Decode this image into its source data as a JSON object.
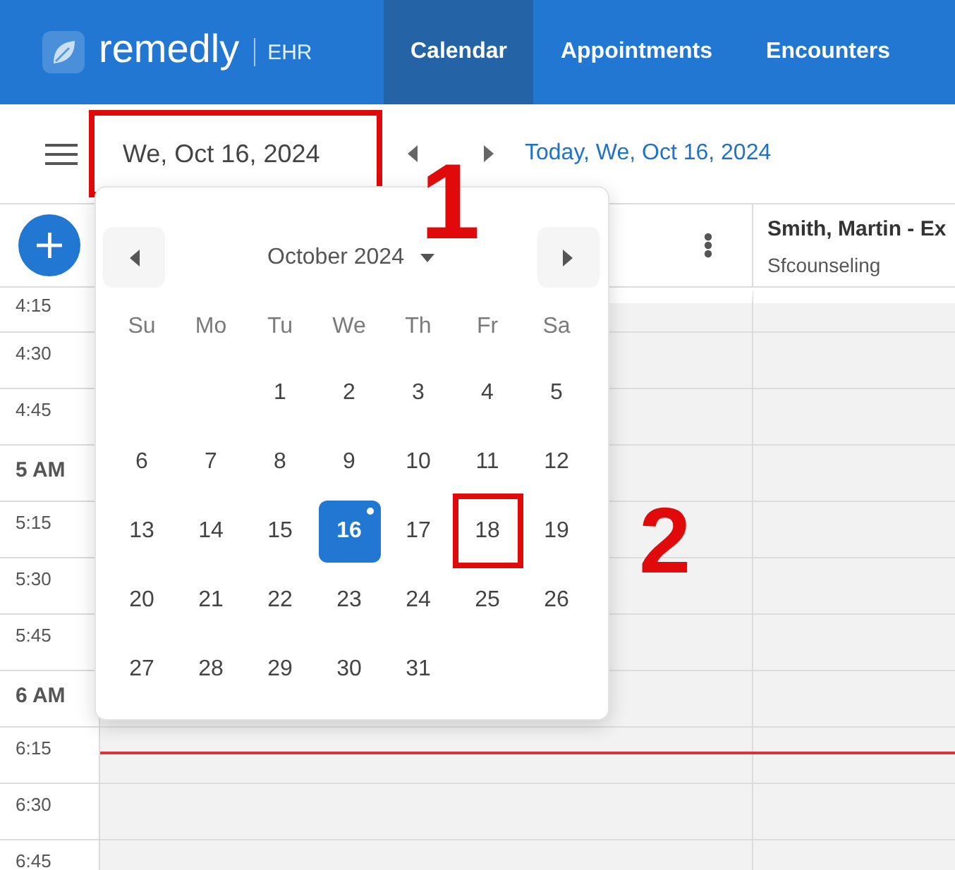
{
  "navbar": {
    "logo": {
      "wordmark": "remedly",
      "product": "EHR"
    },
    "tabs": [
      {
        "label": "Calendar",
        "selected": true
      },
      {
        "label": "Appointments",
        "selected": false
      },
      {
        "label": "Encounters",
        "selected": false
      }
    ]
  },
  "toolbar": {
    "date_field": {
      "value": "We, Oct 16, 2024",
      "highlighted": true
    },
    "today_link": "Today, We, Oct 16, 2024"
  },
  "calendar": {
    "columns": [
      {
        "menu_button": true
      },
      {
        "title": "Smith, Martin - Ex",
        "subtitle": "Sfcounseling",
        "menu_button": false
      }
    ],
    "time_slots": [
      {
        "label": "4:15",
        "kind": "quarter",
        "now": false
      },
      {
        "label": "4:30",
        "kind": "quarter",
        "now": false
      },
      {
        "label": "4:45",
        "kind": "quarter",
        "now": false
      },
      {
        "label": "5 AM",
        "kind": "hour",
        "now": false
      },
      {
        "label": "5:15",
        "kind": "quarter",
        "now": false
      },
      {
        "label": "5:30",
        "kind": "quarter",
        "now": false
      },
      {
        "label": "5:45",
        "kind": "quarter",
        "now": false
      },
      {
        "label": "6 AM",
        "kind": "hour",
        "now": false
      },
      {
        "label": "6:15",
        "kind": "quarter",
        "now": true
      },
      {
        "label": "6:30",
        "kind": "quarter",
        "now": false
      },
      {
        "label": "6:45",
        "kind": "quarter",
        "now": false
      }
    ]
  },
  "date_picker": {
    "month_label": "October 2024",
    "weekdays": [
      "Su",
      "Mo",
      "Tu",
      "We",
      "Th",
      "Fr",
      "Sa"
    ],
    "weeks": [
      [
        {
          "day": "1",
          "selected": false,
          "today": false,
          "highlighted": false
        },
        {
          "day": "2",
          "selected": false,
          "today": false,
          "highlighted": false
        },
        {
          "day": "3",
          "selected": false,
          "today": false,
          "highlighted": false
        },
        {
          "day": "4",
          "selected": false,
          "today": false,
          "highlighted": false
        },
        {
          "day": "5",
          "selected": false,
          "today": false,
          "highlighted": false
        }
      ],
      [
        {
          "day": "6",
          "selected": false,
          "today": false,
          "highlighted": false
        },
        {
          "day": "7",
          "selected": false,
          "today": false,
          "highlighted": false
        },
        {
          "day": "8",
          "selected": false,
          "today": false,
          "highlighted": false
        },
        {
          "day": "9",
          "selected": false,
          "today": false,
          "highlighted": false
        },
        {
          "day": "10",
          "selected": false,
          "today": false,
          "highlighted": false
        },
        {
          "day": "11",
          "selected": false,
          "today": false,
          "highlighted": false
        },
        {
          "day": "12",
          "selected": false,
          "today": false,
          "highlighted": false
        }
      ],
      [
        {
          "day": "13",
          "selected": false,
          "today": false,
          "highlighted": false
        },
        {
          "day": "14",
          "selected": false,
          "today": false,
          "highlighted": false
        },
        {
          "day": "15",
          "selected": false,
          "today": false,
          "highlighted": false
        },
        {
          "day": "16",
          "selected": true,
          "today": true,
          "highlighted": false
        },
        {
          "day": "17",
          "selected": false,
          "today": false,
          "highlighted": false
        },
        {
          "day": "18",
          "selected": false,
          "today": false,
          "highlighted": true
        },
        {
          "day": "19",
          "selected": false,
          "today": false,
          "highlighted": false
        }
      ],
      [
        {
          "day": "20",
          "selected": false,
          "today": false,
          "highlighted": false
        },
        {
          "day": "21",
          "selected": false,
          "today": false,
          "highlighted": false
        },
        {
          "day": "22",
          "selected": false,
          "today": false,
          "highlighted": false
        },
        {
          "day": "23",
          "selected": false,
          "today": false,
          "highlighted": false
        },
        {
          "day": "24",
          "selected": false,
          "today": false,
          "highlighted": false
        },
        {
          "day": "25",
          "selected": false,
          "today": false,
          "highlighted": false
        },
        {
          "day": "26",
          "selected": false,
          "today": false,
          "highlighted": false
        }
      ],
      [
        {
          "day": "27",
          "selected": false,
          "today": false,
          "highlighted": false
        },
        {
          "day": "28",
          "selected": false,
          "today": false,
          "highlighted": false
        },
        {
          "day": "29",
          "selected": false,
          "today": false,
          "highlighted": false
        },
        {
          "day": "30",
          "selected": false,
          "today": false,
          "highlighted": false
        },
        {
          "day": "31",
          "selected": false,
          "today": false,
          "highlighted": false
        }
      ]
    ]
  },
  "callouts": [
    {
      "number": "1"
    },
    {
      "number": "2"
    }
  ]
}
